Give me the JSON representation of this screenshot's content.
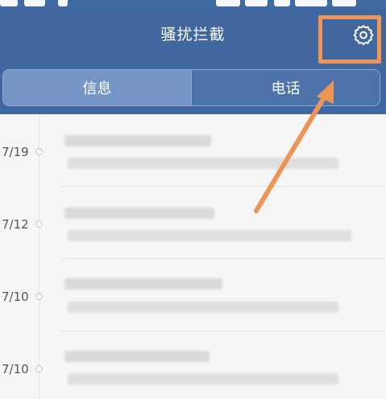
{
  "header": {
    "title": "骚扰拦截",
    "settings_icon": "gear-icon"
  },
  "tabs": [
    {
      "label": "信息",
      "active": true
    },
    {
      "label": "电话",
      "active": false
    }
  ],
  "messages": [
    {
      "date": "7/19"
    },
    {
      "date": "7/12"
    },
    {
      "date": "7/10"
    },
    {
      "date": "7/10"
    }
  ],
  "colors": {
    "header_bg": "#40679f",
    "tab_active": "#7596c4",
    "annotation": "#ee9556"
  }
}
